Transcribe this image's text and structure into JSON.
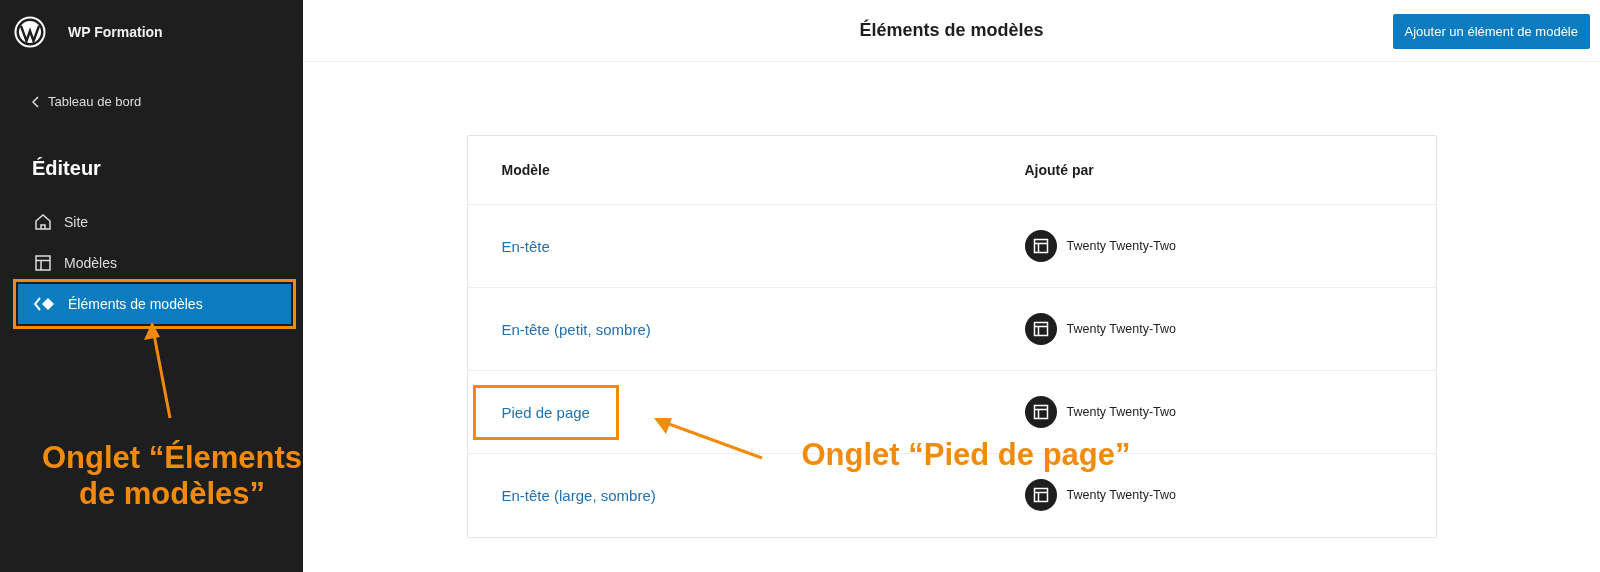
{
  "site": {
    "name": "WP Formation"
  },
  "back_link": {
    "label": "Tableau de bord"
  },
  "sidebar": {
    "title": "Éditeur",
    "items": [
      {
        "label": "Site",
        "kind": "home",
        "selected": false,
        "highlighted": false
      },
      {
        "label": "Modèles",
        "kind": "layout",
        "selected": false,
        "highlighted": false
      },
      {
        "label": "Éléments de modèles",
        "kind": "diamond",
        "selected": true,
        "highlighted": true
      }
    ]
  },
  "header": {
    "title": "Éléments de modèles",
    "button": "Ajouter un élément de modèle"
  },
  "table": {
    "columns": [
      "Modèle",
      "Ajouté par"
    ],
    "rows": [
      {
        "name": "En-tête",
        "author": "Twenty Twenty-Two",
        "highlighted": false
      },
      {
        "name": "En-tête (petit, sombre)",
        "author": "Twenty Twenty-Two",
        "highlighted": false
      },
      {
        "name": "Pied de page",
        "author": "Twenty Twenty-Two",
        "highlighted": true
      },
      {
        "name": "En-tête (large, sombre)",
        "author": "Twenty Twenty-Two",
        "highlighted": false
      }
    ]
  },
  "annotations": [
    {
      "text": "Onglet “Élements de modèles”"
    },
    {
      "text": "Onglet “Pied de page”"
    }
  ]
}
